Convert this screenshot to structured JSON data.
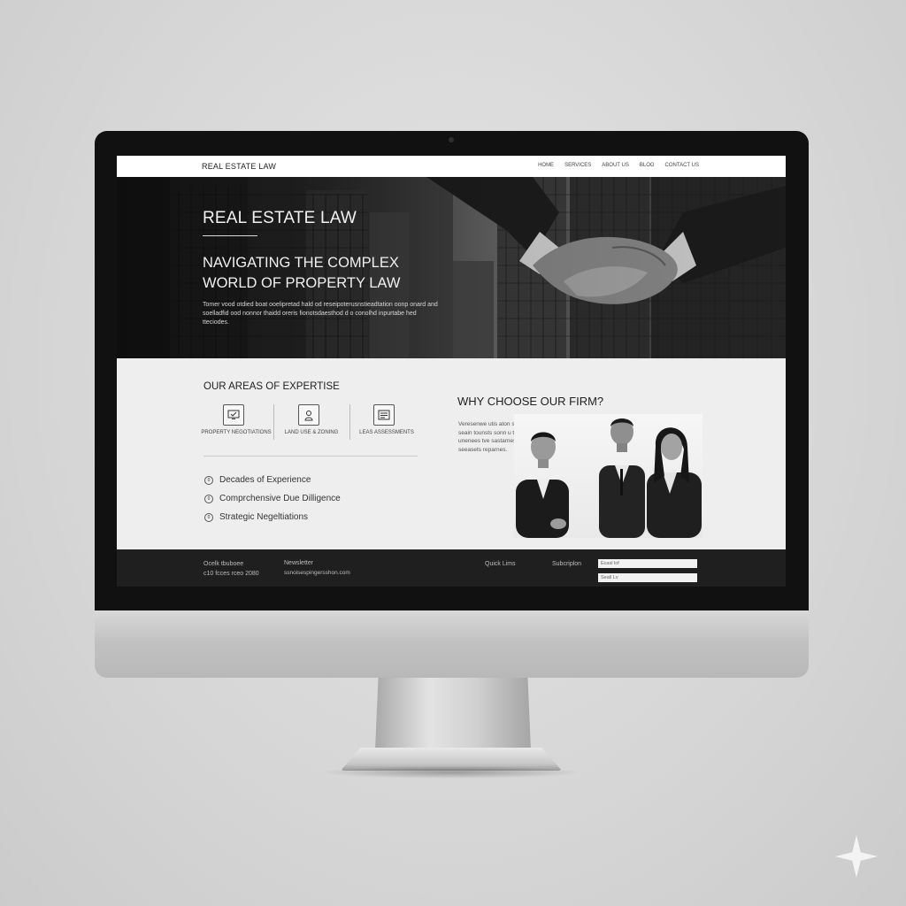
{
  "header": {
    "brand": "REAL ESTATE LAW",
    "nav": [
      "HOME",
      "SERVICES",
      "ABOUT US",
      "BLOG",
      "CONTACT US"
    ]
  },
  "hero": {
    "title": "REAL ESTATE LAW",
    "heading_line1": "NAVIGATING THE COMPLEX",
    "heading_line2": "WORLD OF PROPERTY LAW",
    "body": "Tomer vood otdied boat ooelipretad hald od reseipoterusnstieadtation oonp onard and soelladfid ood nonnor thaidd oreris fionotsdaesthod d o conolhd inpurtabe hed tteciodes."
  },
  "expertise": {
    "title": "OUR AREAS OF EXPERTISE",
    "cards": [
      {
        "icon": "monitor-icon",
        "label": "PROPERTY NEGOTIATIONS"
      },
      {
        "icon": "person-lock-icon",
        "label": "LAND USE & ZONING"
      },
      {
        "icon": "document-icon",
        "label": "LEAS ASSESSMENTS"
      }
    ],
    "features": [
      {
        "bullet": "0",
        "label": "Decades of Experience"
      },
      {
        "bullet": "0",
        "label": "Comprchensive Due Dilligence"
      },
      {
        "bullet": "0",
        "label": "Strategic Negeltiations"
      }
    ]
  },
  "why": {
    "title": "WHY CHOOSE OUR FIRM?",
    "body": "Veresenwe utis aton seoetoes so seain tounsts sonn u tsasts nouve unenees tve sastarnes bue seeasets reparnes."
  },
  "footer": {
    "col1_line1": "Ocelk tbuboee",
    "col1_line2": "c10 fcces rceo 2080",
    "newsletter_title": "Newsletter",
    "newsletter_email": "ssnoisespingersshon.com",
    "quick_links": "Quick Lims",
    "subscription": "Subcriplon",
    "email_placeholder": "Ecasl lof",
    "submit_label": "Seall Lv"
  },
  "colors": {
    "page_bg": "#d6d6d6",
    "bezel": "#111111",
    "footer_bg": "#1f1f1f",
    "content_bg": "#eeeeee"
  }
}
